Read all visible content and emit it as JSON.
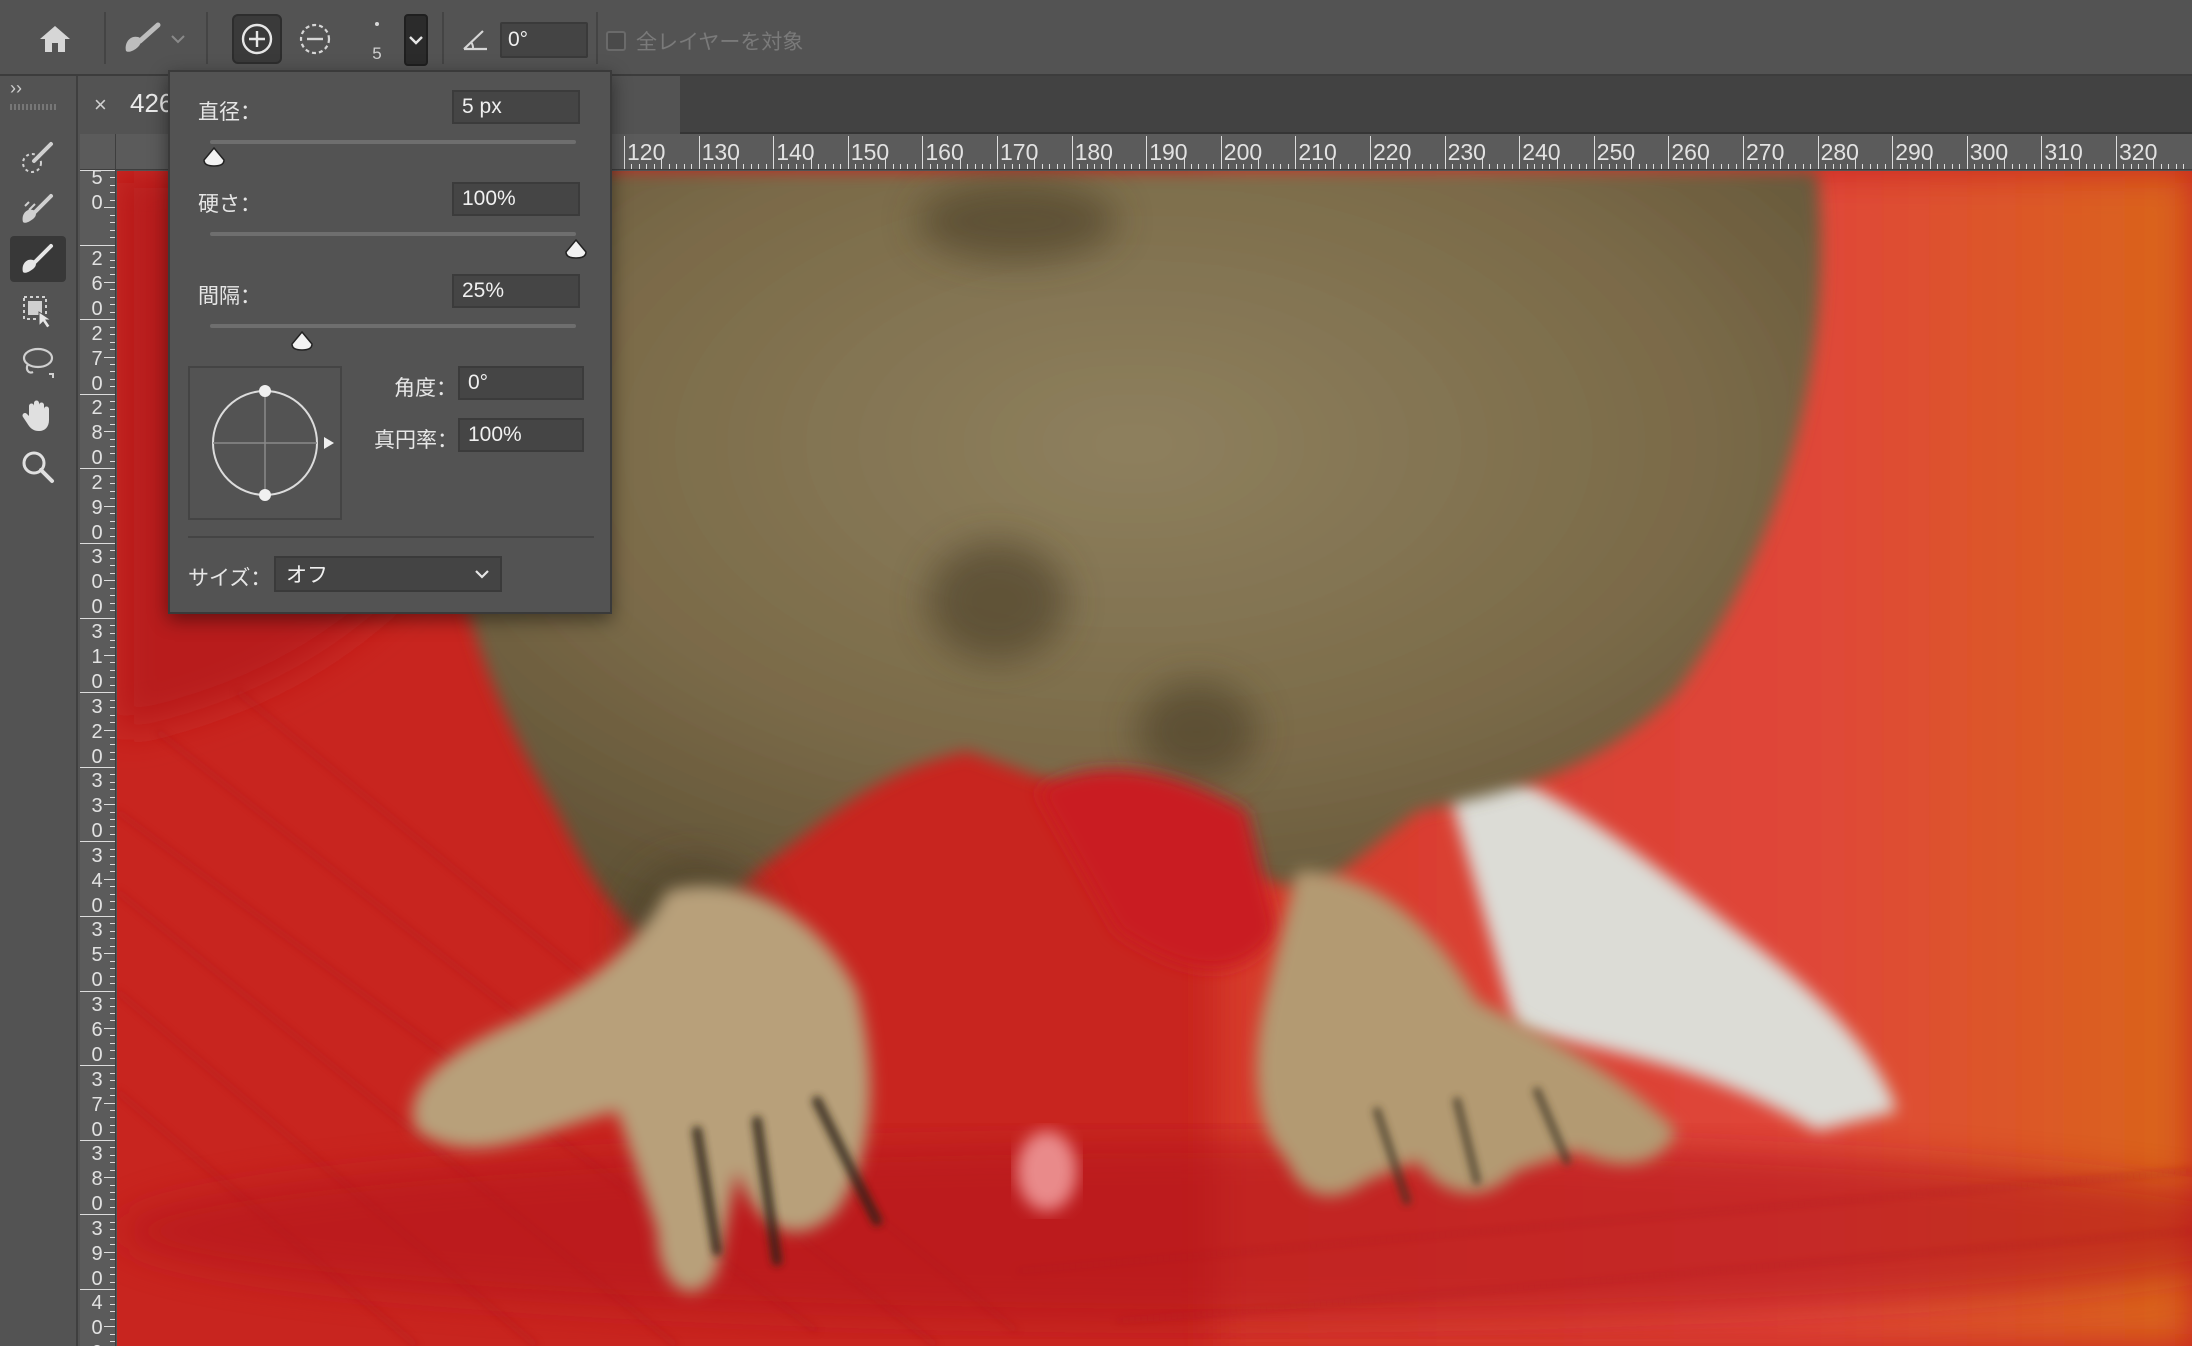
{
  "options_bar": {
    "size_value": "5",
    "angle_value": "0°",
    "all_layers_label": "全レイヤーを対象"
  },
  "document": {
    "tab_title": "426"
  },
  "rulers": {
    "top_labels": [
      "120",
      "130",
      "140",
      "150",
      "160",
      "170",
      "180",
      "190",
      "200",
      "210",
      "220",
      "230",
      "240",
      "250",
      "260",
      "270",
      "280",
      "290",
      "300",
      "310",
      "320"
    ],
    "left_labels": [
      [
        "5",
        "0"
      ],
      [
        "2",
        "6",
        "0"
      ],
      [
        "2",
        "7",
        "0"
      ],
      [
        "2",
        "8",
        "0"
      ],
      [
        "2",
        "9",
        "0"
      ],
      [
        "3",
        "0",
        "0"
      ],
      [
        "3",
        "1",
        "0"
      ],
      [
        "3",
        "2",
        "0"
      ],
      [
        "3",
        "3",
        "0"
      ],
      [
        "3",
        "4",
        "0"
      ],
      [
        "3",
        "5",
        "0"
      ],
      [
        "3",
        "6",
        "0"
      ],
      [
        "3",
        "7",
        "0"
      ],
      [
        "3",
        "8",
        "0"
      ],
      [
        "3",
        "9",
        "0"
      ],
      [
        "4",
        "0",
        "0"
      ]
    ]
  },
  "brush_panel": {
    "diameter_label": "直径：",
    "diameter_value": "5 px",
    "hardness_label": "硬さ：",
    "hardness_value": "100%",
    "spacing_label": "間隔：",
    "spacing_value": "25%",
    "angle_label": "角度：",
    "angle_value": "0°",
    "roundness_label": "真円率：",
    "roundness_value": "100%",
    "size_label": "サイズ：",
    "size_option": "オフ",
    "hardness_percent": 100,
    "spacing_percent": 25
  },
  "toolbar": {
    "collapse_glyph": "››"
  },
  "colors": {
    "panel_bg": "#535353",
    "canvas_red": "#c92020",
    "fur": "#8a7a58"
  }
}
